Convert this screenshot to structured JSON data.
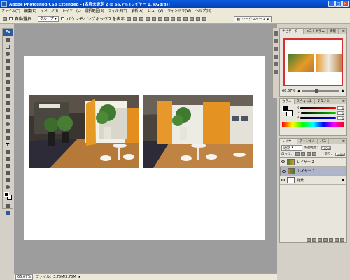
{
  "window": {
    "title": "Adobe Photoshop CS3 Extended - [名称未設定 2 @ 66.7% (レイヤー 1, RGB/8)]",
    "controls": [
      "_",
      "□",
      "×"
    ]
  },
  "menu": [
    "ファイル(F)",
    "編集(E)",
    "イメージ(I)",
    "レイヤー(L)",
    "選択範囲(S)",
    "フィルタ(T)",
    "解析(A)",
    "ビュー(V)",
    "ウィンドウ(W)",
    "ヘルプ(H)"
  ],
  "options": {
    "auto_select_label": "自動選択：",
    "auto_select_value": "グループ",
    "bounding_box_label": "バウンディングボックスを表示",
    "workspace_label": "ワークスペース"
  },
  "navigator": {
    "tabs": [
      "ナビゲーター",
      "ヒストグラム",
      "情報"
    ],
    "zoom": "66.67%"
  },
  "color": {
    "tabs": [
      "カラー",
      "スウォッチ",
      "スタイル"
    ],
    "channels": [
      {
        "label": "R",
        "value": "0"
      },
      {
        "label": "G",
        "value": "0"
      },
      {
        "label": "B",
        "value": "0"
      }
    ]
  },
  "layers": {
    "tabs": [
      "レイヤー",
      "チャンネル",
      "パス"
    ],
    "blend_mode": "通常",
    "opacity_label": "不透明度：",
    "opacity_value": "100%",
    "fill_label": "塗り：",
    "fill_value": "100%",
    "lock_label": "ロック：",
    "items": [
      {
        "name": "レイヤー 2",
        "selected": false
      },
      {
        "name": "レイヤー 1",
        "selected": true
      },
      {
        "name": "背景",
        "selected": false
      }
    ]
  },
  "status": {
    "zoom": "66.67%",
    "file_info": "ファイル：3.75M/3.75M"
  },
  "colors": {
    "accent": "#0a5ce0",
    "canvas_bg": "#9d9d9d",
    "selection": "#aeb4c9"
  }
}
